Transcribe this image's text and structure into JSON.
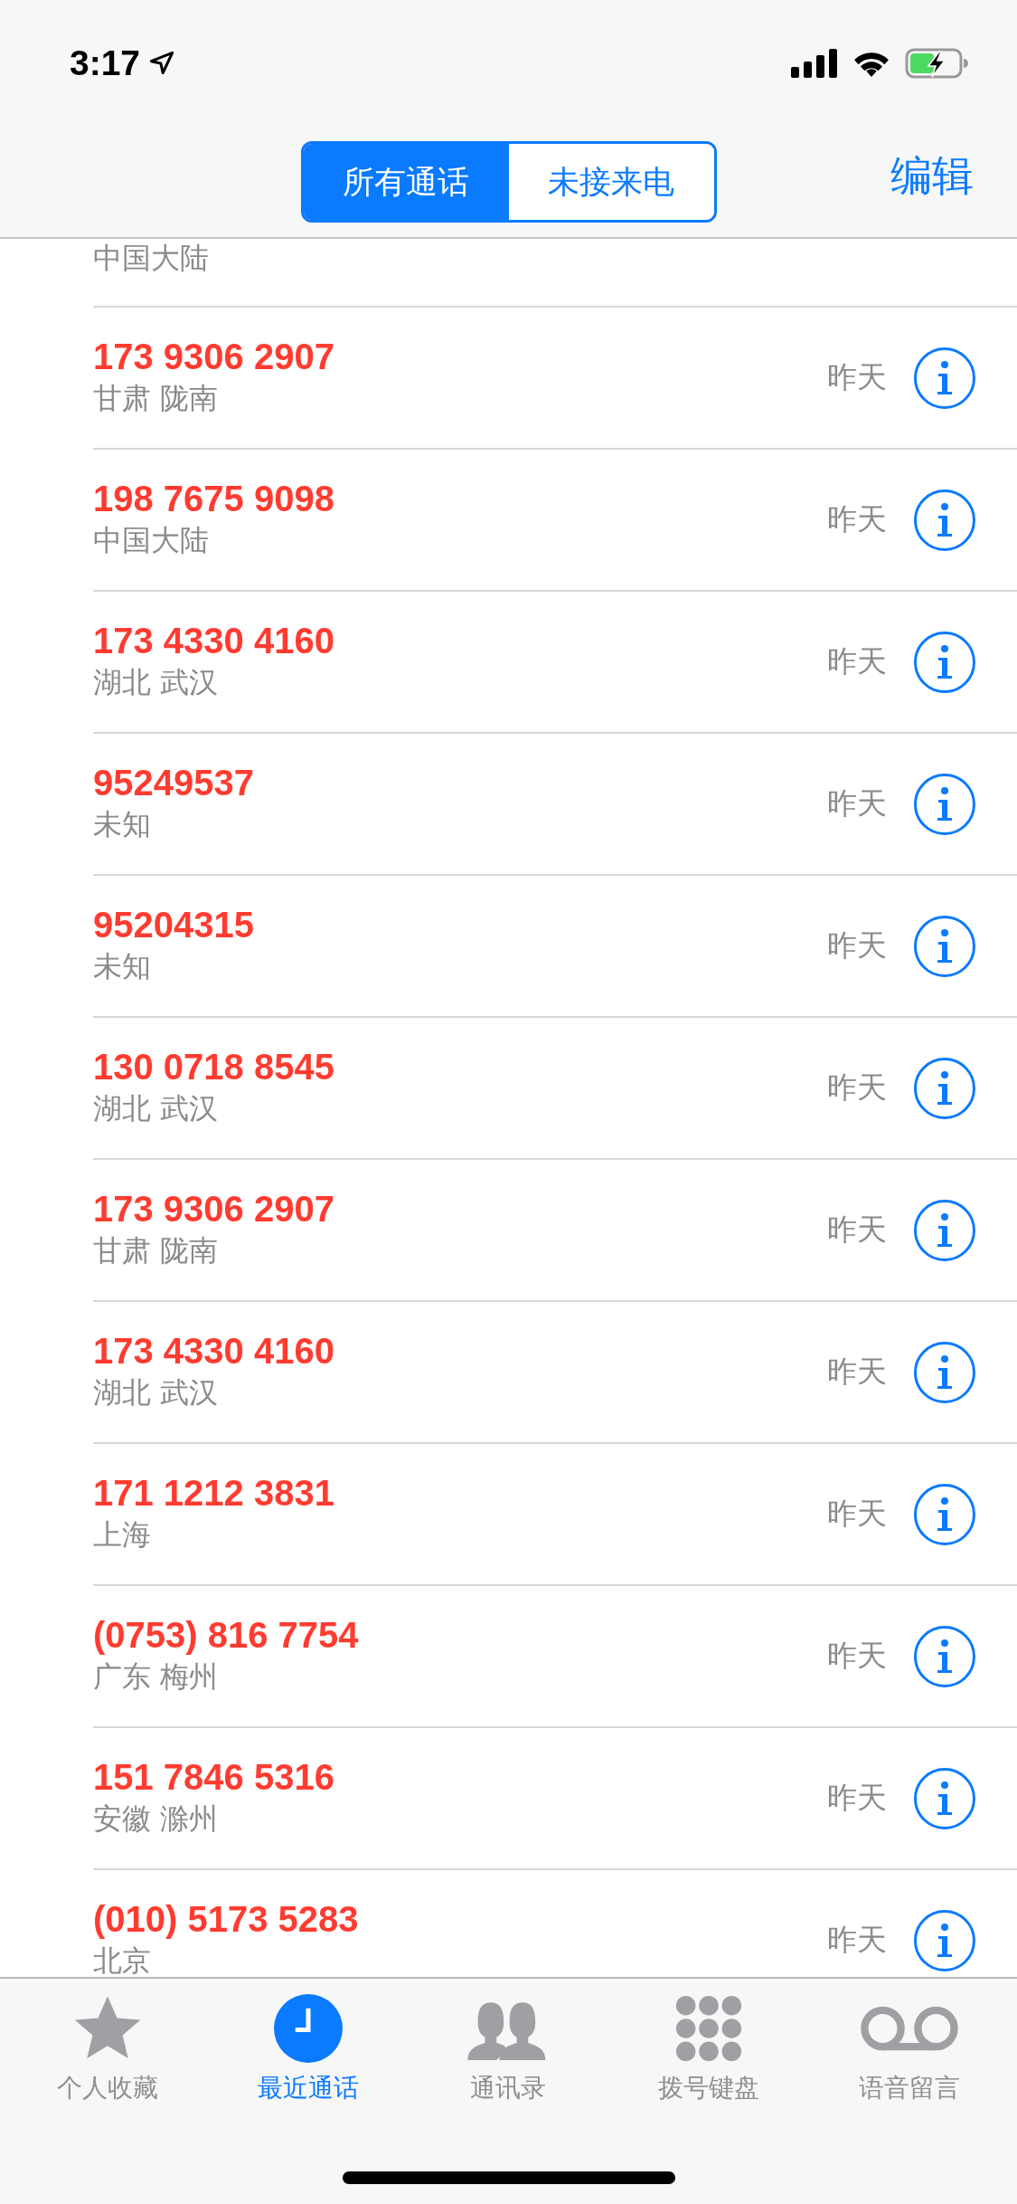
{
  "status_bar": {
    "time": "3:17"
  },
  "nav": {
    "segments": [
      {
        "label": "所有通话",
        "selected": true
      },
      {
        "label": "未接来电",
        "selected": false
      }
    ],
    "edit": "编辑"
  },
  "calls": [
    {
      "kind": "partial",
      "location": "中国大陆"
    },
    {
      "kind": "full",
      "number": "173 9306 2907",
      "location": "甘肃 陇南",
      "time": "昨天",
      "missed": true
    },
    {
      "kind": "full",
      "number": "198 7675 9098",
      "location": "中国大陆",
      "time": "昨天",
      "missed": true
    },
    {
      "kind": "full",
      "number": "173 4330 4160",
      "location": "湖北 武汉",
      "time": "昨天",
      "missed": true
    },
    {
      "kind": "full",
      "number": "95249537",
      "location": "未知",
      "time": "昨天",
      "missed": true
    },
    {
      "kind": "full",
      "number": "95204315",
      "location": "未知",
      "time": "昨天",
      "missed": true
    },
    {
      "kind": "full",
      "number": "130 0718 8545",
      "location": "湖北 武汉",
      "time": "昨天",
      "missed": true
    },
    {
      "kind": "full",
      "number": "173 9306 2907",
      "location": "甘肃 陇南",
      "time": "昨天",
      "missed": true
    },
    {
      "kind": "full",
      "number": "173 4330 4160",
      "location": "湖北 武汉",
      "time": "昨天",
      "missed": true
    },
    {
      "kind": "full",
      "number": "171 1212 3831",
      "location": "上海",
      "time": "昨天",
      "missed": true
    },
    {
      "kind": "full",
      "number": "(0753) 816 7754",
      "location": "广东 梅州",
      "time": "昨天",
      "missed": true
    },
    {
      "kind": "full",
      "number": "151 7846 5316",
      "location": "安徽 滁州",
      "time": "昨天",
      "missed": true
    },
    {
      "kind": "full",
      "number": "(010) 5173 5283",
      "location": "北京",
      "time": "昨天",
      "missed": true
    }
  ],
  "tab_bar": [
    {
      "kind": "favorites",
      "label": "个人收藏",
      "selected": false
    },
    {
      "kind": "recents",
      "label": "最近通话",
      "selected": true
    },
    {
      "kind": "contacts",
      "label": "通讯录",
      "selected": false
    },
    {
      "kind": "keypad",
      "label": "拨号键盘",
      "selected": false
    },
    {
      "kind": "voicemail",
      "label": "语音留言",
      "selected": false
    }
  ]
}
